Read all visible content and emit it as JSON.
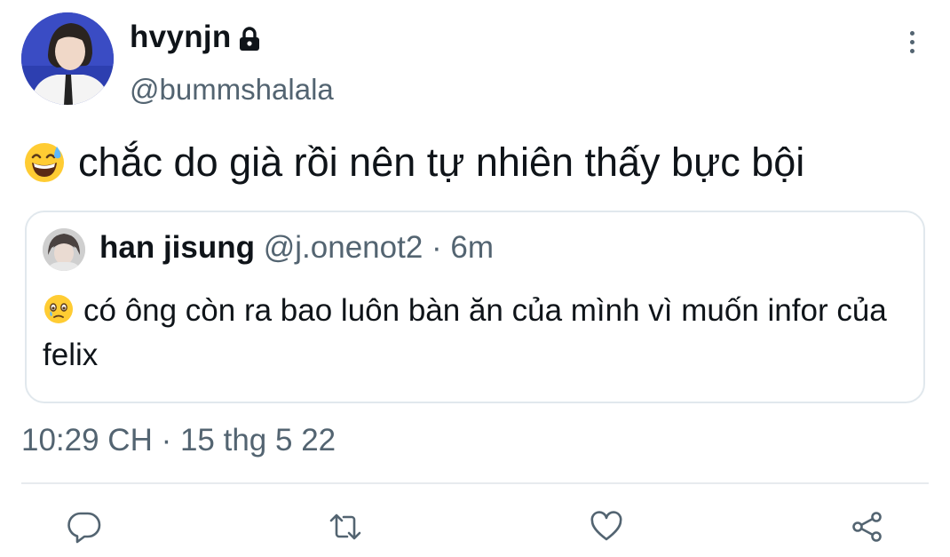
{
  "tweet": {
    "display_name": "hvynjn",
    "handle": "@bummshalala",
    "text": "chắc do già rồi nên tự nhiên thấy bực bội",
    "emoji": "grinning-face-with-sweat",
    "timestamp": "10:29 CH · 15 thg 5 22",
    "locked": true
  },
  "quote": {
    "display_name": "han jisung",
    "handle": "@j.onenot2",
    "separator": "·",
    "time": "6m",
    "emoji": "face-holding-back-tears",
    "text": "có ông còn ra bao luôn bàn ăn của mình vì muốn infor của felix"
  },
  "actions": [
    {
      "name": "reply",
      "icon": "reply-icon"
    },
    {
      "name": "retweet",
      "icon": "retweet-icon"
    },
    {
      "name": "like",
      "icon": "heart-icon"
    },
    {
      "name": "share",
      "icon": "share-icon"
    }
  ],
  "colors": {
    "text_primary": "#0f1419",
    "text_secondary": "#536471",
    "border": "#e1e8ed",
    "avatar_background": "#2d3fa8"
  }
}
